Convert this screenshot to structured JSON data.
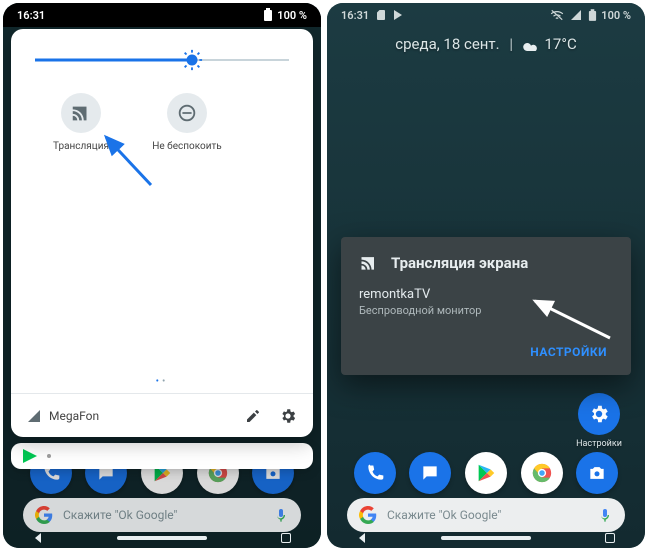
{
  "left": {
    "statusbar": {
      "time": "16:31",
      "battery": "100 %"
    },
    "brightness": {
      "percent": 62
    },
    "tiles": [
      {
        "label": "Трансляция",
        "icon": "cast-icon"
      },
      {
        "label": "Не беспокоить",
        "icon": "dnd-icon"
      }
    ],
    "carrier": "MegaFon",
    "search_hint": "Скажите \"Ok Google\""
  },
  "right": {
    "statusbar": {
      "time": "16:31",
      "battery": "100 %"
    },
    "date": "среда, 18 сент.",
    "weather": "17°C",
    "cast_dialog": {
      "title": "Трансляция экрана",
      "device": "remontkaTV",
      "subtitle": "Беспроводной монитор",
      "action": "НАСТРОЙКИ"
    },
    "settings_label": "Настройки",
    "search_hint": "Скажите \"Ok Google\""
  },
  "icons": {
    "phone": "phone-icon",
    "messages": "messages-icon",
    "play_store": "play-store-icon",
    "chrome": "chrome-icon",
    "camera": "camera-icon"
  }
}
